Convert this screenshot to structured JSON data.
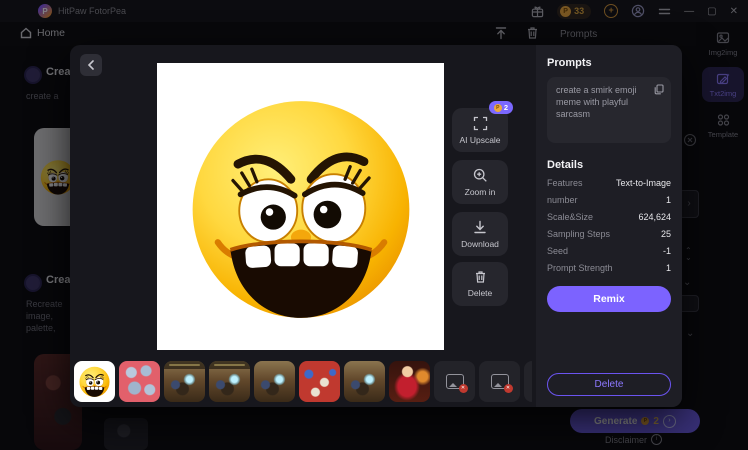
{
  "window": {
    "title": "HitPaw FotorPea",
    "credits": "33"
  },
  "nav": {
    "home_label": "Home",
    "prompts_label": "Prompts"
  },
  "sidebar": {
    "items": [
      {
        "label": "Img2img"
      },
      {
        "label": "Txt2img",
        "active": true
      },
      {
        "label": "Template"
      }
    ]
  },
  "background": {
    "creation1": {
      "title": "Creation",
      "desc": "create a"
    },
    "creation2": {
      "title": "Creation",
      "desc_lines": [
        "Recreate",
        "image,",
        "palette,"
      ]
    },
    "generate": {
      "label": "Generate",
      "cost": "2"
    },
    "disclaimer_label": "Disclaimer"
  },
  "modal": {
    "prompts": {
      "heading": "Prompts",
      "text": "create a smirk emoji meme with playful sarcasm"
    },
    "details": {
      "heading": "Details",
      "rows": [
        {
          "label": "Features",
          "value": "Text-to-Image"
        },
        {
          "label": "number",
          "value": "1"
        },
        {
          "label": "Scale&Size",
          "value": "624,624"
        },
        {
          "label": "Sampling Steps",
          "value": "25"
        },
        {
          "label": "Seed",
          "value": "-1"
        },
        {
          "label": "Prompt Strength",
          "value": "1"
        }
      ]
    },
    "remix_label": "Remix",
    "delete_label": "Delete",
    "actions": [
      {
        "label": "AI Upscale",
        "badge": "2"
      },
      {
        "label": "Zoom in"
      },
      {
        "label": "Download"
      },
      {
        "label": "Delete"
      }
    ],
    "thumbnails": [
      {
        "kind": "emoji",
        "selected": true
      },
      {
        "kind": "robots"
      },
      {
        "kind": "mine-banner"
      },
      {
        "kind": "mine-banner"
      },
      {
        "kind": "mine"
      },
      {
        "kind": "cartoon-red"
      },
      {
        "kind": "mine"
      },
      {
        "kind": "woman"
      },
      {
        "kind": "placeholder"
      },
      {
        "kind": "placeholder"
      },
      {
        "kind": "placeholder"
      }
    ]
  },
  "colors": {
    "accent": "#7c63ff",
    "coin": "#eca93c",
    "panel": "#1e1e25",
    "modal": "#17171d"
  }
}
